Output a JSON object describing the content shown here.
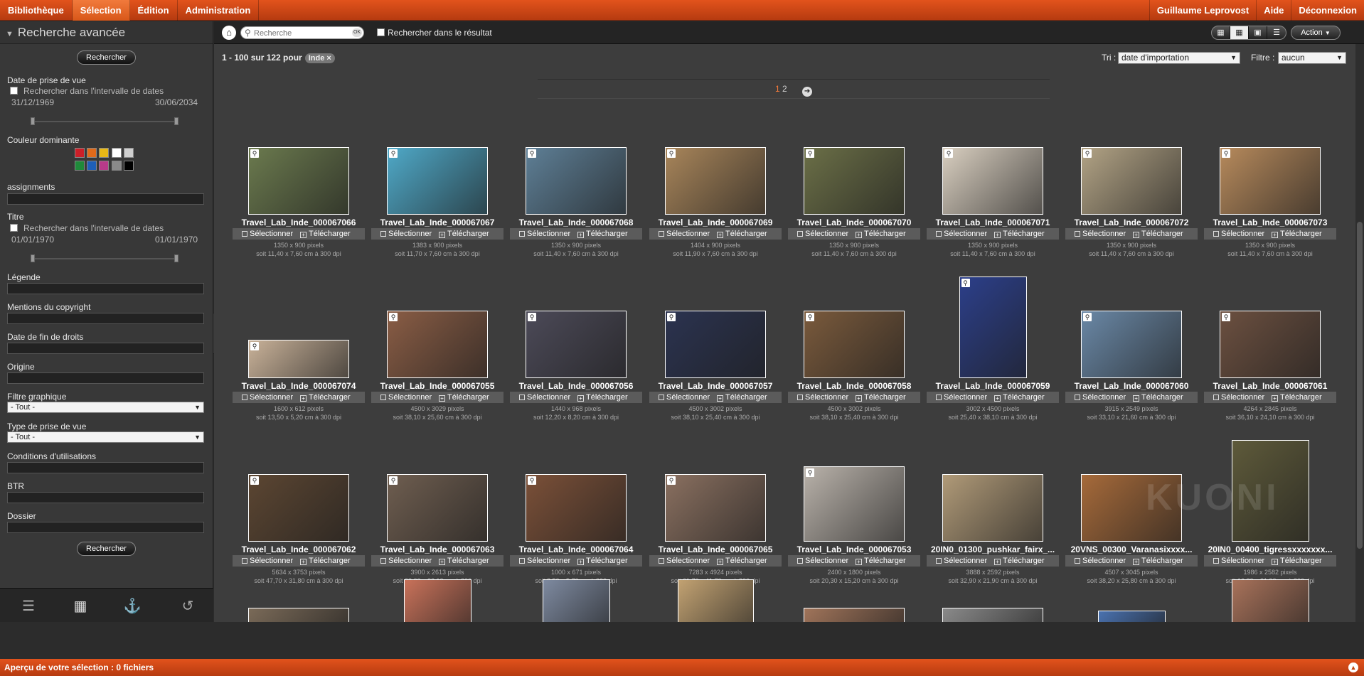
{
  "topnav": {
    "items": [
      "Bibliothèque",
      "Sélection",
      "Édition",
      "Administration"
    ],
    "user": "Guillaume Leprovost",
    "help": "Aide",
    "logout": "Déconnexion"
  },
  "sidebar": {
    "title": "Recherche avancée",
    "search_button": "Rechercher",
    "shoot_date_label": "Date de prise de vue",
    "date_range_label": "Rechercher dans l'intervalle de dates",
    "shoot_date_from": "31/12/1969",
    "shoot_date_to": "30/06/2034",
    "color_label": "Couleur dominante",
    "color_swatches": [
      "#cc1f28",
      "#e06a1a",
      "#e8b816",
      "#1f8a3a",
      "#1f5fb8",
      "#b83a8a"
    ],
    "tone_swatches": [
      "#ffffff",
      "#cfcfcf",
      "#8a8a8a",
      "#000000"
    ],
    "assignments_label": "assignments",
    "title_label": "Titre",
    "title_date_label": "Rechercher dans l'intervalle de dates",
    "title_date_from": "01/01/1970",
    "title_date_to": "01/01/1970",
    "legend_label": "Légende",
    "copyright_label": "Mentions du copyright",
    "rights_end_label": "Date de fin de droits",
    "origin_label": "Origine",
    "graphic_filter_label": "Filtre graphique",
    "graphic_filter_value": "- Tout -",
    "shot_type_label": "Type de prise de vue",
    "shot_type_value": "- Tout -",
    "conditions_label": "Conditions d'utilisations",
    "btr_label": "BTR",
    "folder_label": "Dossier",
    "search_button_bottom": "Rechercher"
  },
  "toolbar": {
    "search_placeholder": "Recherche",
    "ok": "OK",
    "in_result_label": "Rechercher dans le résultat",
    "action_label": "Action"
  },
  "results": {
    "count": "1 - 100 sur 122 pour",
    "tag": "Inde ×",
    "sort_label": "Tri :",
    "sort_value": "date d'importation",
    "filter_label": "Filtre :",
    "filter_value": "aucun"
  },
  "pager": {
    "current": "1",
    "next_page": "2"
  },
  "card_actions": {
    "select": "Sélectionner",
    "download": "Télécharger"
  },
  "images": [
    {
      "name": "Travel_Lab_Inde_000067066",
      "px": "1350 x 900 pixels",
      "cm": "soit 11,40 x 7,60 cm à 300 dpi",
      "color": "#6b7a4e",
      "pin": true
    },
    {
      "name": "Travel_Lab_Inde_000067067",
      "px": "1383 x 900 pixels",
      "cm": "soit 11,70 x 7,60 cm à 300 dpi",
      "color": "#4fa9c8",
      "pin": true
    },
    {
      "name": "Travel_Lab_Inde_000067068",
      "px": "1350 x 900 pixels",
      "cm": "soit 11,40 x 7,60 cm à 300 dpi",
      "color": "#5e7f96",
      "pin": true
    },
    {
      "name": "Travel_Lab_Inde_000067069",
      "px": "1404 x 900 pixels",
      "cm": "soit 11,90 x 7,60 cm à 300 dpi",
      "color": "#a8855a",
      "pin": true
    },
    {
      "name": "Travel_Lab_Inde_000067070",
      "px": "1350 x 900 pixels",
      "cm": "soit 11,40 x 7,60 cm à 300 dpi",
      "color": "#6b6f47",
      "pin": true
    },
    {
      "name": "Travel_Lab_Inde_000067071",
      "px": "1350 x 900 pixels",
      "cm": "soit 11,40 x 7,60 cm à 300 dpi",
      "color": "#d9cfc0",
      "pin": true
    },
    {
      "name": "Travel_Lab_Inde_000067072",
      "px": "1350 x 900 pixels",
      "cm": "soit 11,40 x 7,60 cm à 300 dpi",
      "color": "#b2a385",
      "pin": true
    },
    {
      "name": "Travel_Lab_Inde_000067073",
      "px": "1350 x 900 pixels",
      "cm": "soit 11,40 x 7,60 cm à 300 dpi",
      "color": "#b78a5c",
      "pin": true
    },
    {
      "name": "Travel_Lab_Inde_000067074",
      "px": "1600 x 612 pixels",
      "cm": "soit 13,50 x 5,20 cm à 300 dpi",
      "color": "#c9b299",
      "pin": true
    },
    {
      "name": "Travel_Lab_Inde_000067055",
      "px": "4500 x 3029 pixels",
      "cm": "soit 38,10 x 25,60 cm à 300 dpi",
      "color": "#8a5d45",
      "pin": true
    },
    {
      "name": "Travel_Lab_Inde_000067056",
      "px": "1440 x 968 pixels",
      "cm": "soit 12,20 x 8,20 cm à 300 dpi",
      "color": "#4c4a58",
      "pin": true
    },
    {
      "name": "Travel_Lab_Inde_000067057",
      "px": "4500 x 3002 pixels",
      "cm": "soit 38,10 x 25,40 cm à 300 dpi",
      "color": "#2b3350",
      "pin": true
    },
    {
      "name": "Travel_Lab_Inde_000067058",
      "px": "4500 x 3002 pixels",
      "cm": "soit 38,10 x 25,40 cm à 300 dpi",
      "color": "#7a5a3c",
      "pin": true
    },
    {
      "name": "Travel_Lab_Inde_000067059",
      "px": "3002 x 4500 pixels",
      "cm": "soit 25,40 x 38,10 cm à 300 dpi",
      "color": "#2c3f8a",
      "pin": true
    },
    {
      "name": "Travel_Lab_Inde_000067060",
      "px": "3915 x 2549 pixels",
      "cm": "soit 33,10 x 21,60 cm à 300 dpi",
      "color": "#6a88a6",
      "pin": true
    },
    {
      "name": "Travel_Lab_Inde_000067061",
      "px": "4264 x 2845 pixels",
      "cm": "soit 36,10 x 24,10 cm à 300 dpi",
      "color": "#6c5040",
      "pin": true
    },
    {
      "name": "Travel_Lab_Inde_000067062",
      "px": "5634 x 3753 pixels",
      "cm": "soit 47,70 x 31,80 cm à 300 dpi",
      "color": "#5c4632",
      "pin": true
    },
    {
      "name": "Travel_Lab_Inde_000067063",
      "px": "3900 x 2613 pixels",
      "cm": "soit 33,00 x 22,10 cm à 300 dpi",
      "color": "#6f5e50",
      "pin": true
    },
    {
      "name": "Travel_Lab_Inde_000067064",
      "px": "1000 x 671 pixels",
      "cm": "soit 8,50 x 5,70 cm à 300 dpi",
      "color": "#7b5038",
      "pin": true
    },
    {
      "name": "Travel_Lab_Inde_000067065",
      "px": "7283 x 4924 pixels",
      "cm": "soit 61,70 x 41,70 cm à 300 dpi",
      "color": "#8a7060",
      "pin": true
    },
    {
      "name": "Travel_Lab_Inde_000067053",
      "px": "2400 x 1800 pixels",
      "cm": "soit 20,30 x 15,20 cm à 300 dpi",
      "color": "#b9b2aa",
      "pin": true
    },
    {
      "name": "20IN0_01300_pushkar_fairx_...",
      "px": "3888 x 2592 pixels",
      "cm": "soit 32,90 x 21,90 cm à 300 dpi",
      "color": "#b09a78",
      "pin": false
    },
    {
      "name": "20VNS_00300_Varanasixxxx...",
      "px": "4507 x 3045 pixels",
      "cm": "soit 38,20 x 25,80 cm à 300 dpi",
      "color": "#a66a3a",
      "pin": false
    },
    {
      "name": "20IN0_00400_tigressxxxxxxx...",
      "px": "1986 x 2582 pixels",
      "cm": "soit 16,80 x 21,90 cm à 300 dpi",
      "color": "#5e5a3a",
      "pin": false
    }
  ],
  "partial_thumb_colors": [
    "#7a6a58",
    "#c9725a",
    "#7e8aa0",
    "#c2a272",
    "#a0745a",
    "#8a8a8a",
    "#4a72b0",
    "#a8725a"
  ],
  "watermark": "KUONI",
  "footer": {
    "text": "Aperçu de votre sélection : 0 fichiers"
  }
}
